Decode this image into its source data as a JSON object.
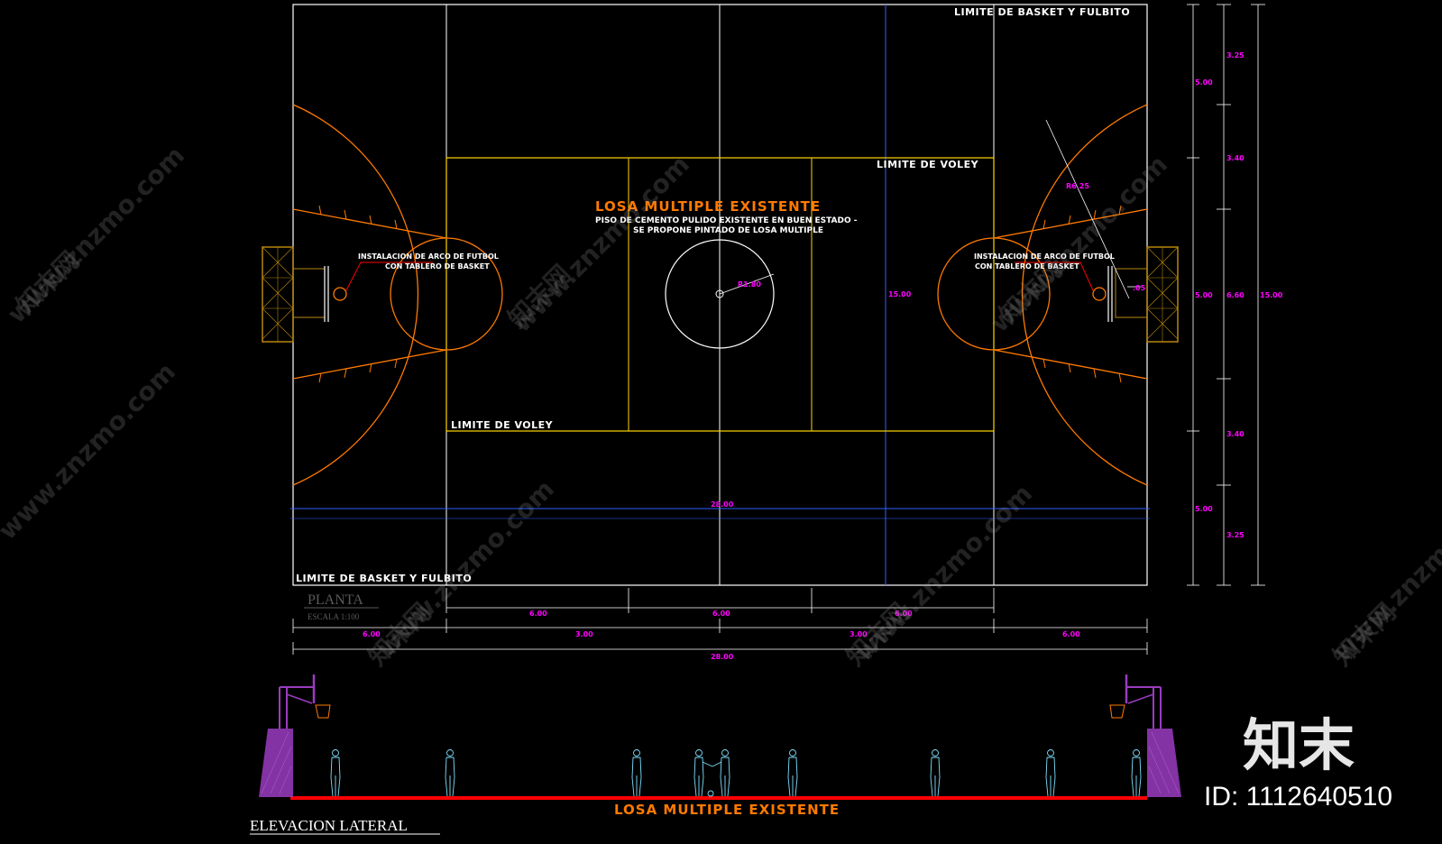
{
  "plan": {
    "limite_basket_top": "LIMITE DE BASKET Y FULBITO",
    "limite_basket_bottom": "LIMITE DE BASKET Y FULBITO",
    "limite_voley_top": "LIMITE DE VOLEY",
    "limite_voley_bottom": "LIMITE DE VOLEY",
    "main_title": "LOSA MULTIPLE EXISTENTE",
    "subtitle_line1": "PISO DE CEMENTO PULIDO EXISTENTE EN BUEN ESTADO -",
    "subtitle_line2": "SE PROPONE PINTADO DE LOSA MULTIPLE",
    "note_left_line1": "INSTALACION DE ARCO DE FUTBOL",
    "note_left_line2": "CON TABLERO DE BASKET",
    "note_right_line1": "INSTALACION DE ARCO DE FUTBOL",
    "note_right_line2": "CON TABLERO DE BASKET",
    "center_radius": "R1.80",
    "arc_radius": "R6.25",
    "small_dim": ".05",
    "plan_title": "PLANTA",
    "plan_scale": "ESCALA 1:100"
  },
  "dimensions": {
    "width_total": "28.00",
    "width_total_bottom": "28.00",
    "height_center": "15.00",
    "row1": [
      "6.00",
      "6.00",
      "6.00"
    ],
    "row2": [
      "6.00",
      "3.00",
      "3.00",
      "6.00"
    ],
    "right_col1": [
      "5.00",
      "5.00",
      "5.00"
    ],
    "right_col2": [
      "3.25",
      "3.40",
      "6.60",
      "3.40",
      "3.25"
    ],
    "right_total": "15.00"
  },
  "elevation": {
    "title": "ELEVACION LATERAL",
    "slab_label": "LOSA MULTIPLE EXISTENTE"
  },
  "watermark": {
    "site": "www.znzmo.com",
    "brand": "知末网",
    "logo": "知末",
    "id": "ID: 1112640510"
  },
  "colors": {
    "court_line": "#ffffff",
    "basket_orange": "#ff7a00",
    "voley_yellow": "#ffd400",
    "dimension_magenta": "#ff00ff",
    "axis_blue": "#3060ff",
    "goal_gold": "#b8860b",
    "slab_red": "#ff0000",
    "figure_cyan": "#7fe0ff",
    "support_purple": "#9a3cc0"
  }
}
